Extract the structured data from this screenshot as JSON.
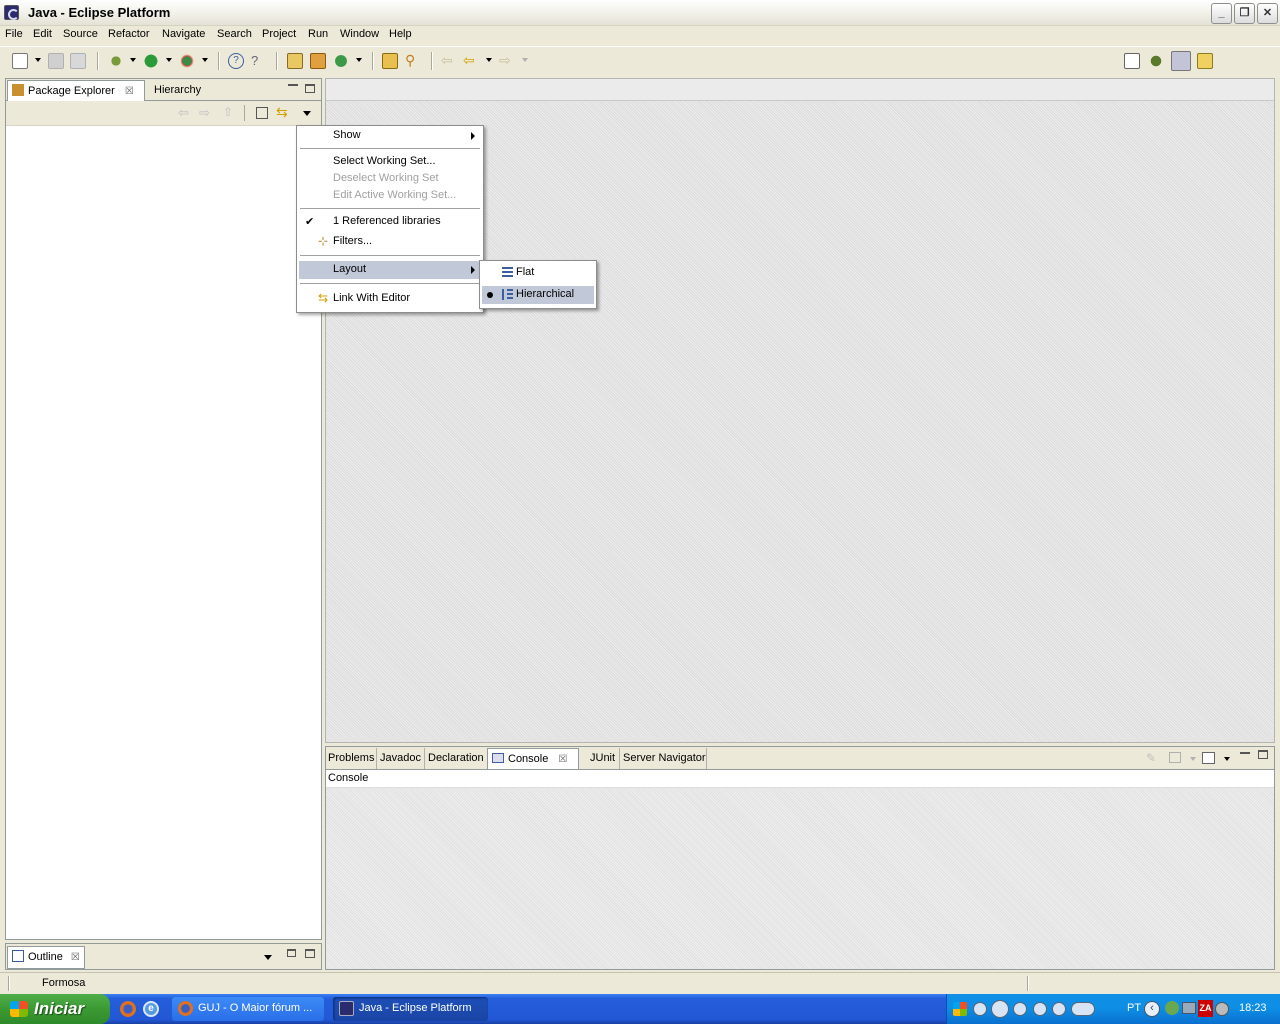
{
  "window": {
    "title": "Java - Eclipse Platform"
  },
  "menubar": {
    "items": [
      "File",
      "Edit",
      "Source",
      "Refactor",
      "Navigate",
      "Search",
      "Project",
      "Run",
      "Window",
      "Help"
    ]
  },
  "package_explorer": {
    "tabs": [
      {
        "label": "Package Explorer"
      },
      {
        "label": "Hierarchy"
      }
    ]
  },
  "context_menu": {
    "show": "Show",
    "select_working_set": "Select Working Set...",
    "deselect_working_set": "Deselect Working Set",
    "edit_active_working_set": "Edit Active Working Set...",
    "referenced_libraries": "1 Referenced libraries",
    "filters": "Filters...",
    "layout": "Layout",
    "link_with_editor": "Link With Editor"
  },
  "layout_submenu": {
    "flat": "Flat",
    "hierarchical": "Hierarchical",
    "selected": "Hierarchical"
  },
  "bottom_panel": {
    "tabs": [
      {
        "label": "Problems"
      },
      {
        "label": "Javadoc"
      },
      {
        "label": "Declaration"
      },
      {
        "label": "Console"
      },
      {
        "label": "JUnit"
      },
      {
        "label": "Server Navigator"
      }
    ],
    "active_tab": "Console",
    "console_title": "Console"
  },
  "outline": {
    "label": "Outline"
  },
  "statusbar": {
    "text": "Formosa"
  },
  "taskbar": {
    "start_label": "Iniciar",
    "tasks": [
      {
        "label": "GUJ - O Maior fórum ..."
      },
      {
        "label": "Java - Eclipse Platform"
      }
    ],
    "language": "PT",
    "clock": "18:23"
  }
}
